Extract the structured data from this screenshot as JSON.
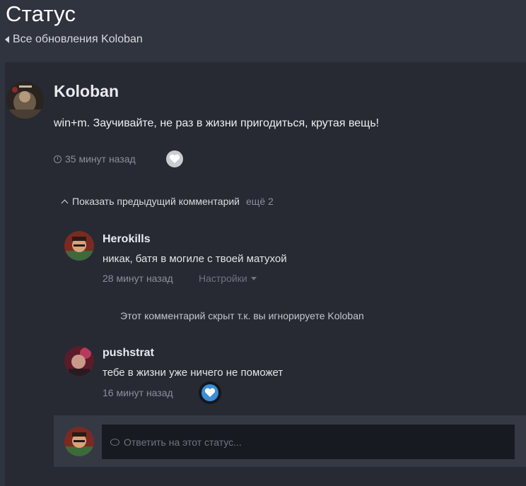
{
  "page": {
    "title": "Статус",
    "breadcrumb": "Все обновления Koloban"
  },
  "status": {
    "author": "Koloban",
    "text": "win+m. Заучивайте, не раз в жизни пригодиться, крутая вещь!",
    "time": "35 минут назад",
    "like_icon": "heart-icon"
  },
  "comments_toggle": {
    "label": "Показать предыдущий комментарий",
    "more": "ещё 2"
  },
  "comments": [
    {
      "author": "Herokills",
      "text": "никак, батя в могиле с твоей матухой",
      "time": "28 минут назад",
      "settings_label": "Настройки"
    },
    {
      "hidden_note": "Этот комментарий скрыт т.к. вы игнорируете Koloban"
    },
    {
      "author": "pushstrat",
      "text": "тебе в жизни уже ничего не поможет",
      "time": "16 минут назад",
      "liked": true
    }
  ],
  "reply": {
    "placeholder": "Ответить на этот статус..."
  },
  "colors": {
    "background": "#30343f",
    "panel": "#272a33",
    "like_active": "#3a8ed6"
  }
}
